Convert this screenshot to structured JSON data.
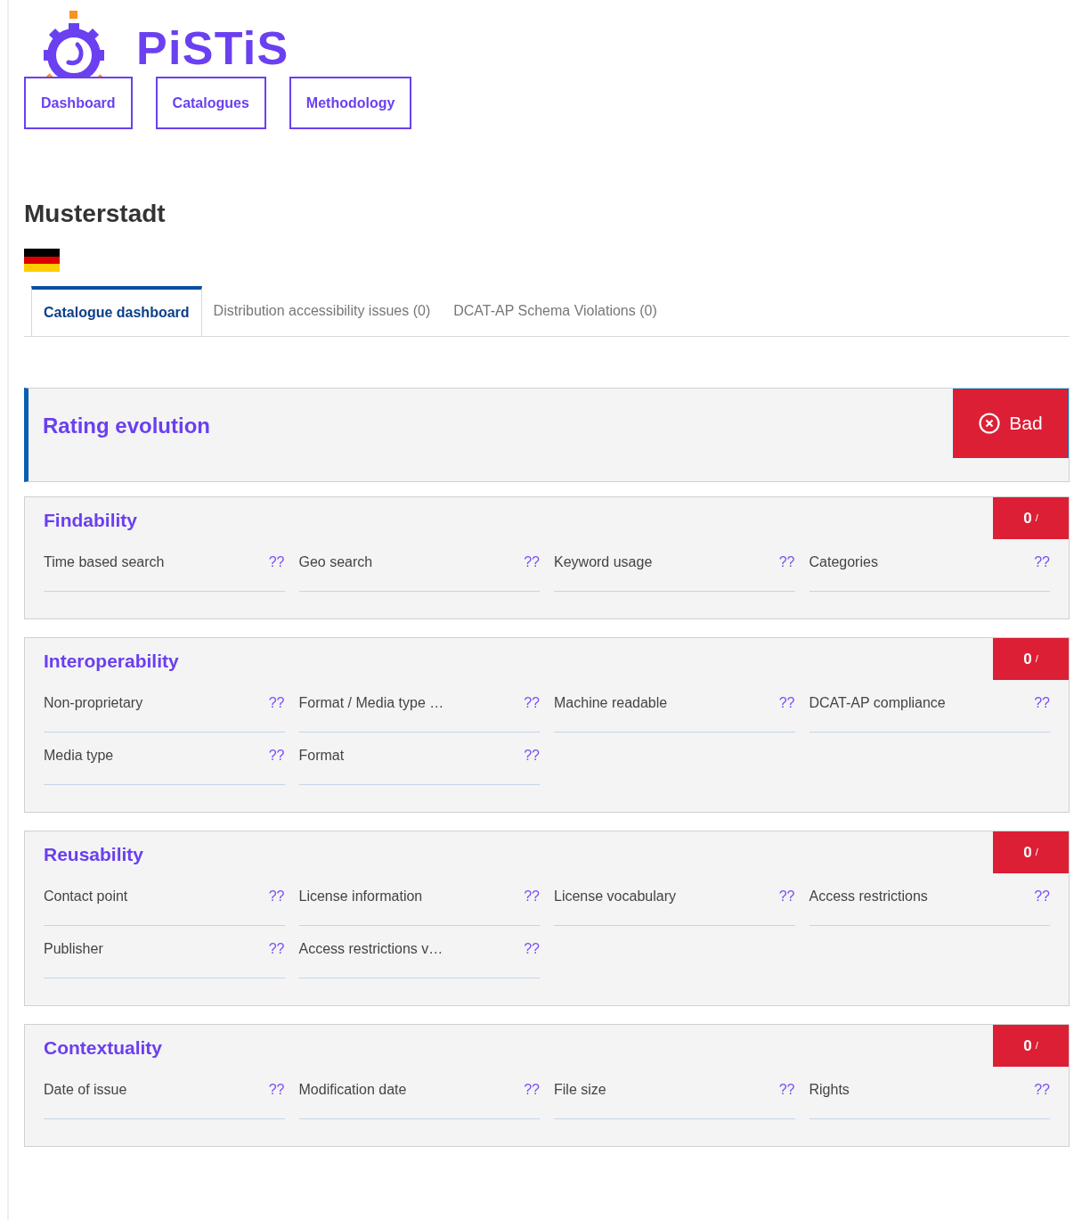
{
  "logo": {
    "text": "PiSTiS"
  },
  "nav": [
    "Dashboard",
    "Catalogues",
    "Methodology"
  ],
  "catalogue": {
    "title": "Musterstadt"
  },
  "tabs": [
    {
      "label": "Catalogue dashboard",
      "selected": true
    },
    {
      "label": "Distribution accessibility issues (0)",
      "selected": false
    },
    {
      "label": "DCAT-AP Schema Violations (0)",
      "selected": false
    }
  ],
  "rating": {
    "title": "Rating evolution",
    "badge": "Bad"
  },
  "sections": [
    {
      "title": "Findability",
      "score": "0",
      "score_suffix": "/",
      "metrics": [
        {
          "label": "Time based search",
          "value": "??"
        },
        {
          "label": "Geo search",
          "value": "??"
        },
        {
          "label": "Keyword usage",
          "value": "??"
        },
        {
          "label": "Categories",
          "value": "??"
        }
      ]
    },
    {
      "title": "Interoperability",
      "score": "0",
      "score_suffix": "/",
      "metrics": [
        {
          "label": "Non-proprietary",
          "value": "??"
        },
        {
          "label": "Format / Media type …",
          "value": "??"
        },
        {
          "label": "Machine readable",
          "value": "??"
        },
        {
          "label": "DCAT-AP compliance",
          "value": "??"
        },
        {
          "label": "Media type",
          "value": "??"
        },
        {
          "label": "Format",
          "value": "??"
        }
      ]
    },
    {
      "title": "Reusability",
      "score": "0",
      "score_suffix": "/",
      "metrics": [
        {
          "label": "Contact point",
          "value": "??"
        },
        {
          "label": "License information",
          "value": "??"
        },
        {
          "label": "License vocabulary",
          "value": "??"
        },
        {
          "label": "Access restrictions",
          "value": "??"
        },
        {
          "label": "Publisher",
          "value": "??"
        },
        {
          "label": "Access restrictions v…",
          "value": "??"
        }
      ]
    },
    {
      "title": "Contextuality",
      "score": "0",
      "score_suffix": "/",
      "metrics": [
        {
          "label": "Date of issue",
          "value": "??"
        },
        {
          "label": "Modification date",
          "value": "??"
        },
        {
          "label": "File size",
          "value": "??"
        },
        {
          "label": "Rights",
          "value": "??"
        }
      ]
    }
  ]
}
